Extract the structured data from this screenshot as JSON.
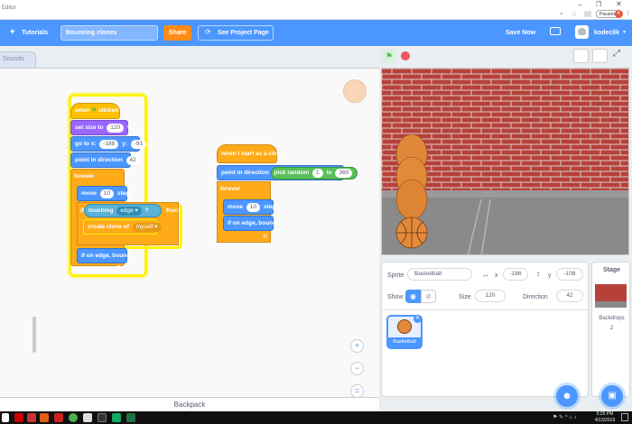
{
  "browser": {
    "tab_title": "Editor",
    "paused_label": "Paused",
    "user_initial": "K"
  },
  "menubar": {
    "tutorials_label": "Tutorials",
    "project_title": "Bouncing clones",
    "share_label": "Share",
    "see_project_label": "See Project Page",
    "save_label": "Save Now",
    "username": "kodeclik"
  },
  "tabs": {
    "sounds_label": "Sounds"
  },
  "script1": {
    "hat": "when",
    "hat_suffix": "clicked",
    "set_size": "set size to",
    "size_val": "120",
    "size_unit": "%",
    "goto": "go to x:",
    "x_val": "-188",
    "y_label": "y:",
    "y_val": "-91",
    "point_dir": "point in direction",
    "dir_val": "42",
    "forever": "forever",
    "move": "move",
    "move_val": "10",
    "steps": "steps",
    "if": "if",
    "touching": "touching",
    "touch_target": "edge",
    "touch_q": "?",
    "then": "then",
    "create_clone": "create clone of",
    "clone_target": "myself",
    "bounce": "if on edge, bounce"
  },
  "script2": {
    "hat": "when I start as a clone",
    "point_dir": "point in direction",
    "pick_random": "pick random",
    "from_val": "1",
    "to_label": "to",
    "to_val": "360",
    "forever": "forever",
    "move": "move",
    "move_val": "10",
    "steps": "steps",
    "bounce": "if on edge, bounce"
  },
  "sprite_info": {
    "sprite_label": "Sprite",
    "sprite_name": "Basketball",
    "x_label": "x",
    "x_val": "-186",
    "y_label": "y",
    "y_val": "-108",
    "show_label": "Show",
    "size_label": "Size",
    "size_val": "120",
    "direction_label": "Direction",
    "direction_val": "42",
    "thumb_label": "Basketball"
  },
  "stage_panel": {
    "title": "Stage",
    "backdrops_label": "Backdrops",
    "backdrops_count": "2"
  },
  "backpack": {
    "label": "Backpack"
  },
  "taskbar": {
    "time": "5:25 PM",
    "date": "4/13/2019"
  },
  "colors": {
    "accent": "#4c97ff",
    "share": "#ff8c1a",
    "highlight": "#fff200"
  }
}
